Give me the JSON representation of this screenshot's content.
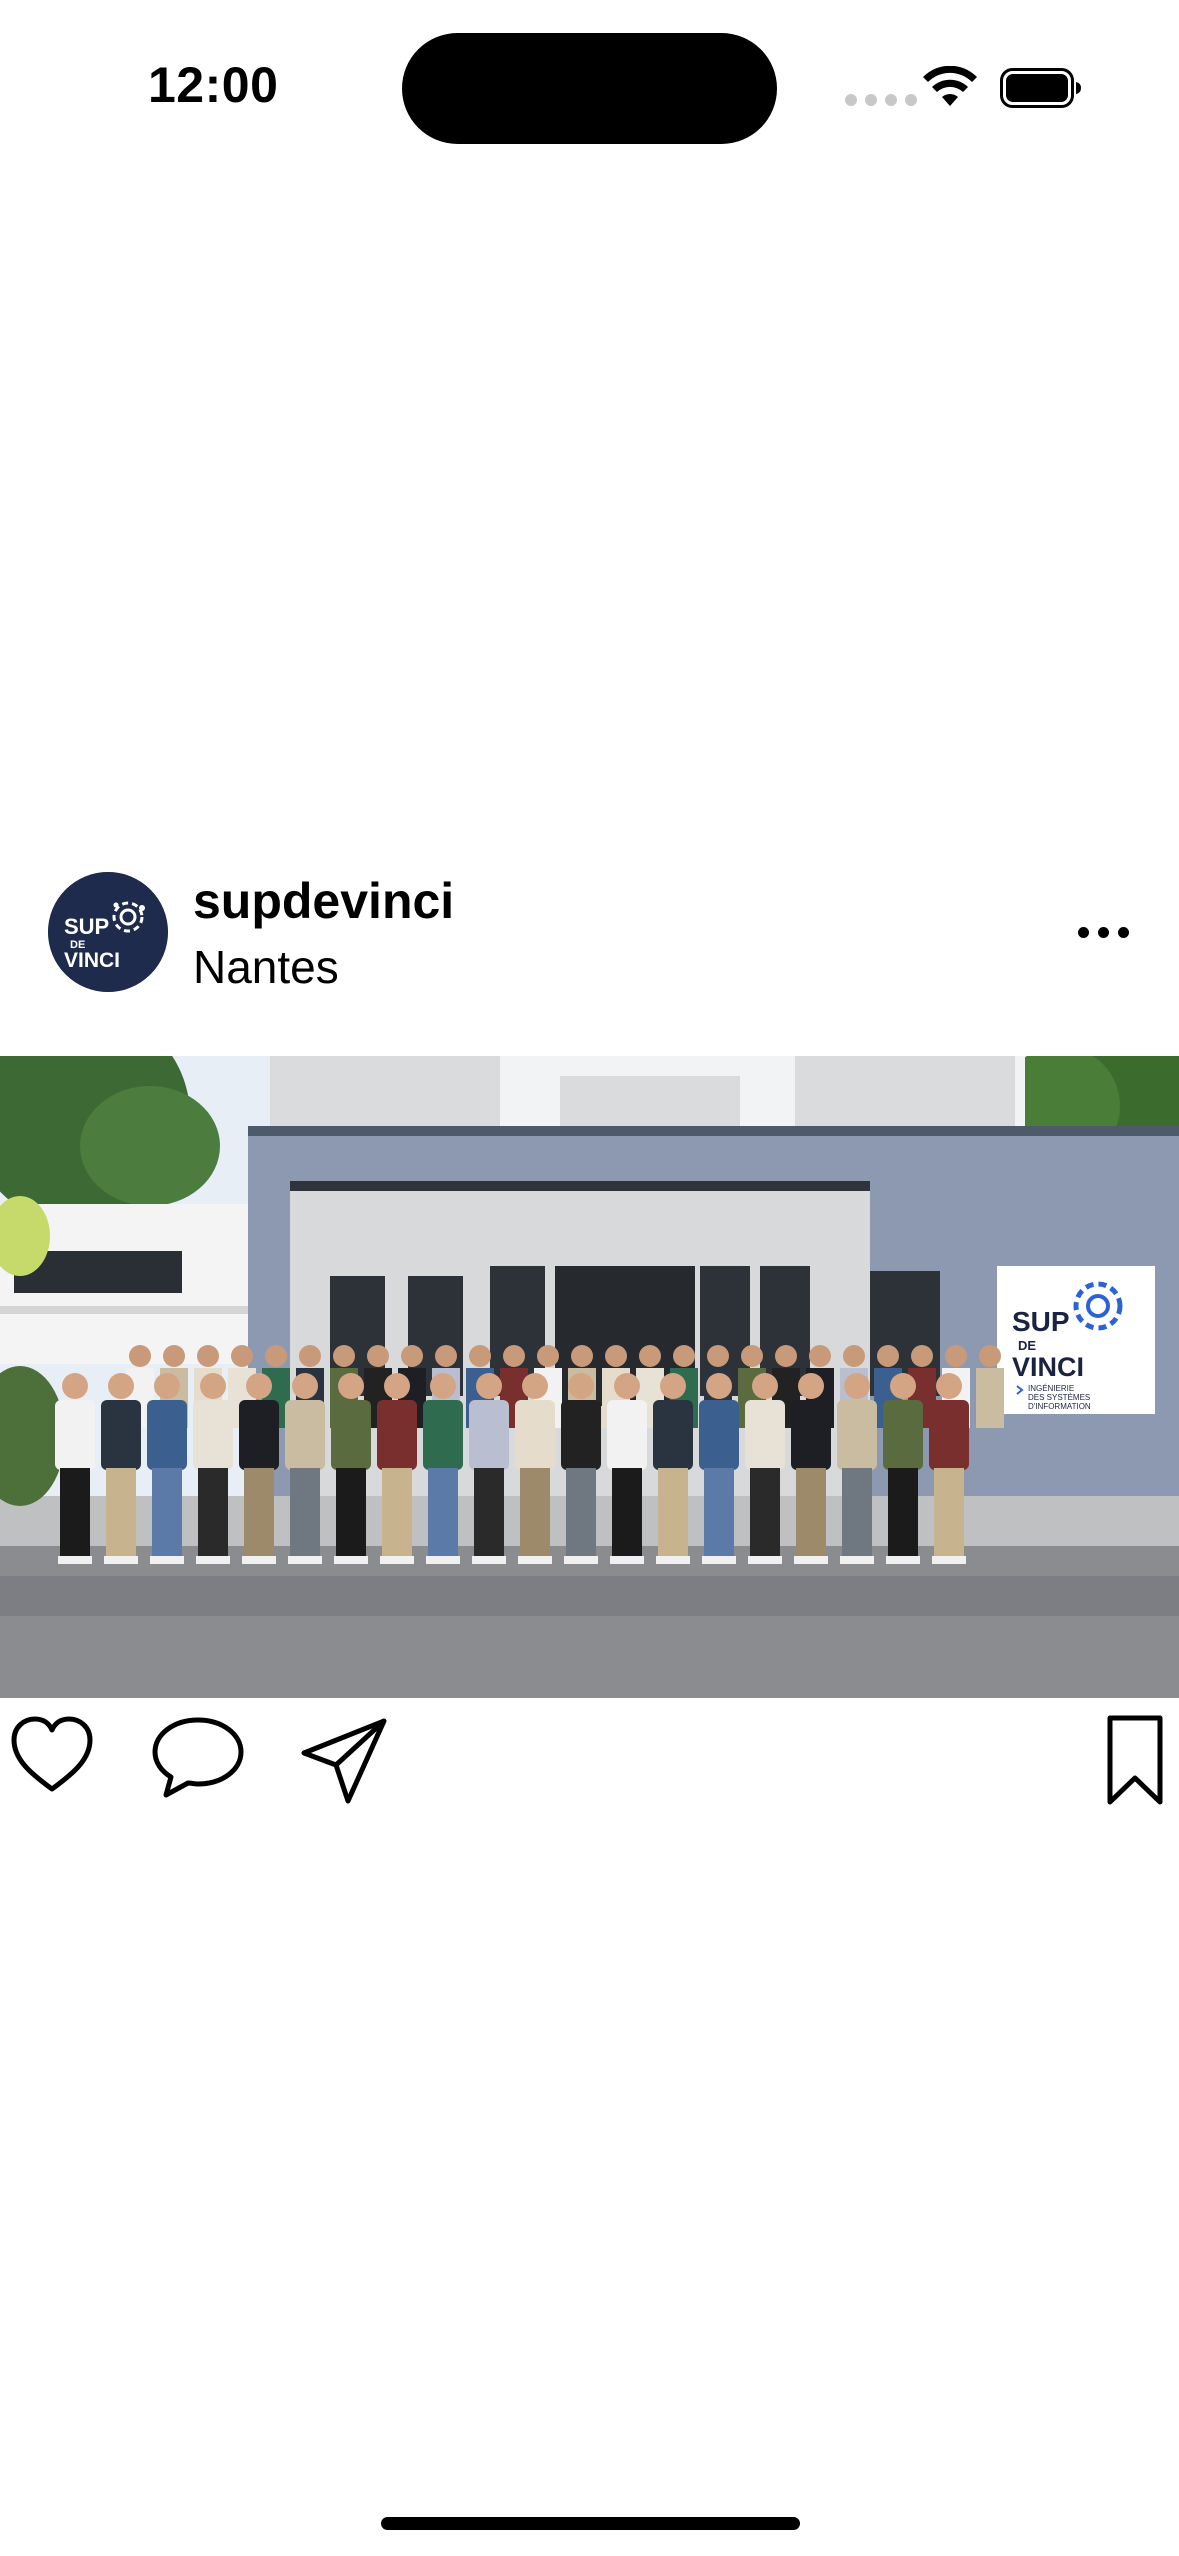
{
  "status_bar": {
    "time": "12:00",
    "icons": [
      "signal-icon",
      "wifi-icon",
      "battery-icon"
    ]
  },
  "post": {
    "username": "supdevinci",
    "location": "Nantes",
    "avatar": {
      "logo_text_line1": "SUP",
      "logo_text_line2": "DE",
      "logo_text_line3": "VINCI",
      "background": "#1e2b4d"
    },
    "image": {
      "sign_text_line1": "SUP",
      "sign_text_line2": "DE",
      "sign_text_line3": "VINCI",
      "sign_subtitle_line1": "INGÉNIERIE",
      "sign_subtitle_line2": "DES SYSTÈMES",
      "sign_subtitle_line3": "D'INFORMATION",
      "brand_blue": "#2b63d6"
    },
    "actions": {
      "like_icon": "heart-icon",
      "comment_icon": "speech-bubble-icon",
      "share_icon": "paper-plane-icon",
      "save_icon": "bookmark-icon"
    }
  }
}
